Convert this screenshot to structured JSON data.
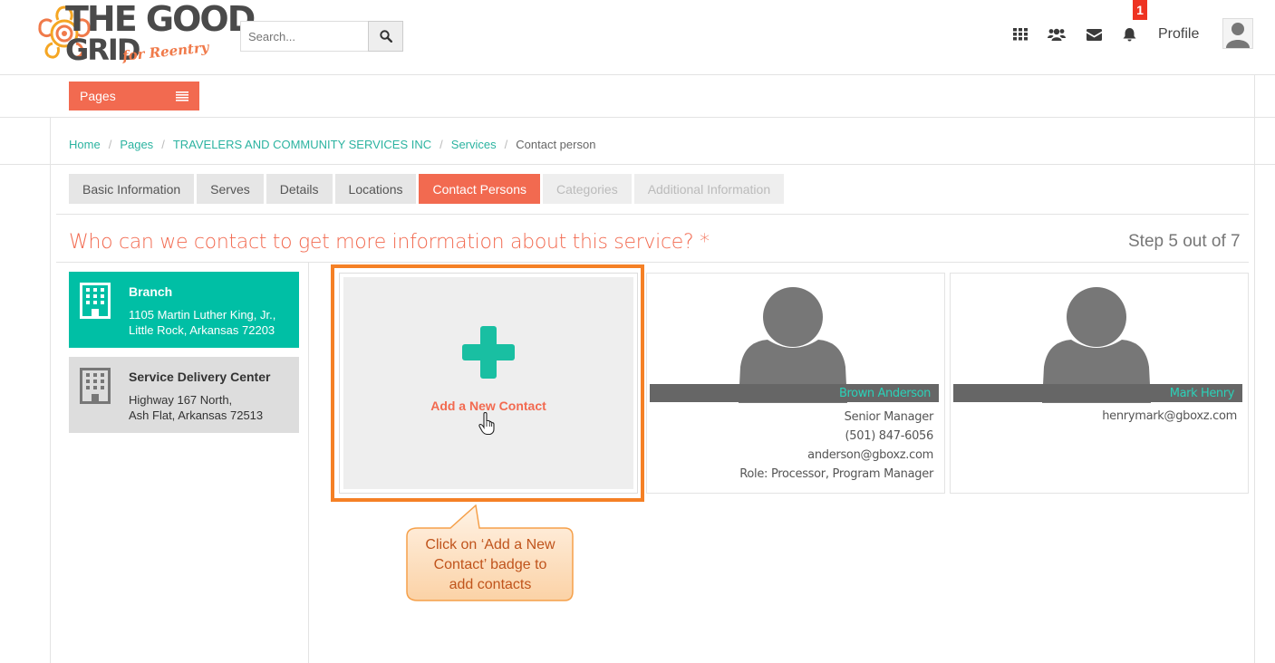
{
  "header": {
    "logo": {
      "line1": "THE GOOD",
      "line2": "GRID",
      "tagline": "for Reentry"
    },
    "search": {
      "placeholder": "Search..."
    },
    "icons": [
      "grid-icon",
      "users-icon",
      "envelope-icon",
      "bell-icon"
    ],
    "notification_count": "1",
    "profile_label": "Profile"
  },
  "nav": {
    "pages_label": "Pages"
  },
  "breadcrumb": [
    {
      "label": "Home"
    },
    {
      "label": "Pages"
    },
    {
      "label": "TRAVELERS AND COMMUNITY SERVICES INC"
    },
    {
      "label": "Services"
    },
    {
      "label": "Contact person"
    }
  ],
  "tabs": [
    {
      "label": "Basic Information",
      "state": "normal"
    },
    {
      "label": "Serves",
      "state": "normal"
    },
    {
      "label": "Details",
      "state": "normal"
    },
    {
      "label": "Locations",
      "state": "normal"
    },
    {
      "label": "Contact Persons",
      "state": "active"
    },
    {
      "label": "Categories",
      "state": "disabled"
    },
    {
      "label": "Additional Information",
      "state": "disabled"
    }
  ],
  "main": {
    "question": "Who can we contact to get more information about this service? *",
    "step": "Step 5 out of 7"
  },
  "locations": [
    {
      "title": "Branch",
      "address1": "1105 Martin Luther King, Jr.,",
      "address2": "Little Rock, Arkansas 72203",
      "selected": true
    },
    {
      "title": "Service Delivery Center",
      "address1": "Highway 167 North,",
      "address2": "Ash Flat, Arkansas 72513",
      "selected": false
    }
  ],
  "add_contact": {
    "label": "Add a New Contact"
  },
  "contacts": [
    {
      "name": "Brown Anderson",
      "title": "Senior Manager",
      "phone": "(501) 847-6056",
      "email": "anderson@gboxz.com",
      "role": "Role:  Processor, Program Manager"
    },
    {
      "name": "Mark Henry",
      "email": "henrymark@gboxz.com"
    }
  ],
  "callout": {
    "line1": "Click on ‘Add a New",
    "line2": "Contact’ badge to",
    "line3": "add contacts"
  },
  "colors": {
    "accent": "#f26a50",
    "teal": "#00bfa5",
    "highlight": "#f58025"
  }
}
